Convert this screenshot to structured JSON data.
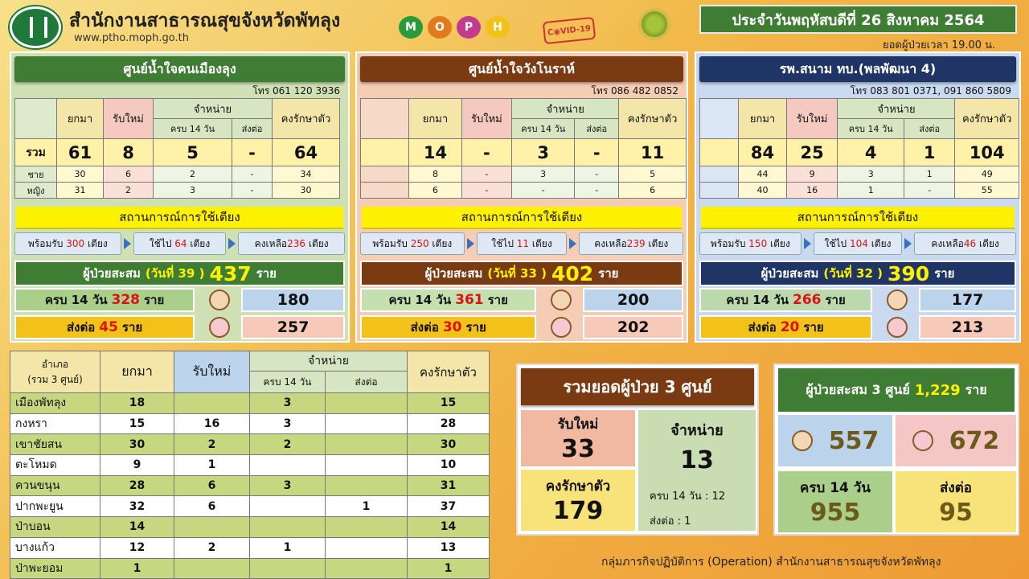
{
  "header": {
    "org": "สำนักงานสาธารณสุขจังหวัดพัทลุง",
    "web": "www.ptho.moph.go.th",
    "moph": [
      "M",
      "O",
      "P",
      "H"
    ],
    "covid": "C◉VID-19",
    "date": "ประจำวันพฤหัสบดีที่ 26 สิงหาคม 2564",
    "time": "ยอดผู้ป่วยเวลา 19.00 น."
  },
  "labels": {
    "carried": "ยกมา",
    "new": "รับใหม่",
    "discharge": "จำหน่าย",
    "d14": "ครบ 14 วัน",
    "refer": "ส่งต่อ",
    "remain": "คงรักษาตัว",
    "total": "รวม",
    "male": "ชาย",
    "female": "หญิง",
    "bed_title": "สถานการณ์การใช้เตียง",
    "acc_label": "ผู้ป่วยสะสม",
    "unit": "ราย"
  },
  "centers": [
    {
      "title": "ศูนย์น้ำใจคนเมืองลุง",
      "phone": "โทร 061 120 3936",
      "total": [
        "61",
        "8",
        "5",
        "-",
        "64"
      ],
      "male": [
        "30",
        "6",
        "2",
        "-",
        "34"
      ],
      "female": [
        "31",
        "2",
        "3",
        "-",
        "30"
      ],
      "bed_ready": "พร้อมรับ",
      "bed_ready_n": "300",
      "bed_used": "ใช้ไป",
      "bed_used_n": "64",
      "bed_left": "คงเหลือ",
      "bed_left_n": "236",
      "bed_unit": "เตียง",
      "acc_day": "(วันที่ 39 )",
      "acc_num": "437",
      "d14_label": "ครบ 14 วัน",
      "d14_num": "328",
      "refer_label": "ส่งต่อ",
      "refer_num": "45",
      "male_total": "180",
      "female_total": "257"
    },
    {
      "title": "ศูนย์น้ำใจวังโนราห์",
      "phone": "โทร 086 482 0852",
      "total": [
        "14",
        "-",
        "3",
        "-",
        "11"
      ],
      "male": [
        "8",
        "-",
        "3",
        "-",
        "5"
      ],
      "female": [
        "6",
        "-",
        "-",
        "-",
        "6"
      ],
      "bed_ready": "พร้อมรับ",
      "bed_ready_n": "250",
      "bed_used": "ใช้ไป",
      "bed_used_n": "11",
      "bed_left": "คงเหลือ",
      "bed_left_n": "239",
      "bed_unit": "เตียง",
      "acc_day": "(วันที่ 33 )",
      "acc_num": "402",
      "d14_label": "ครบ 14 วัน",
      "d14_num": "361",
      "refer_label": "ส่งต่อ",
      "refer_num": "30",
      "male_total": "200",
      "female_total": "202"
    },
    {
      "title": "รพ.สนาม ทบ.(พลพัฒนา 4)",
      "phone": "โทร 083 801 0371, 091 860 5809",
      "total": [
        "84",
        "25",
        "4",
        "1",
        "104"
      ],
      "male": [
        "44",
        "9",
        "3",
        "1",
        "49"
      ],
      "female": [
        "40",
        "16",
        "1",
        "-",
        "55"
      ],
      "bed_ready": "พร้อมรับ",
      "bed_ready_n": "150",
      "bed_used": "ใช้ไป",
      "bed_used_n": "104",
      "bed_left": "คงเหลือ",
      "bed_left_n": "46",
      "bed_unit": "เตียง",
      "acc_day": "(วันที่ 32 )",
      "acc_num": "390",
      "d14_label": "ครบ 14 วัน",
      "d14_num": "266",
      "refer_label": "ส่งต่อ",
      "refer_num": "20",
      "male_total": "177",
      "female_total": "213"
    }
  ],
  "district": {
    "h_amphoe": "อำเภอ",
    "h_sub": "(รวม 3 ศูนย์)",
    "rows": [
      [
        "เมืองพัทลุง",
        "18",
        "",
        "3",
        "",
        "15"
      ],
      [
        "กงหรา",
        "15",
        "16",
        "3",
        "",
        "28"
      ],
      [
        "เขาชัยสน",
        "30",
        "2",
        "2",
        "",
        "30"
      ],
      [
        "ตะโหมด",
        "9",
        "1",
        "",
        "",
        "10"
      ],
      [
        "ควนขนุน",
        "28",
        "6",
        "3",
        "",
        "31"
      ],
      [
        "ปากพะยูน",
        "32",
        "6",
        "",
        "1",
        "37"
      ],
      [
        "ป่าบอน",
        "14",
        "",
        "",
        "",
        "14"
      ],
      [
        "บางแก้ว",
        "12",
        "2",
        "1",
        "",
        "13"
      ],
      [
        "ป่าพะยอม",
        "1",
        "",
        "",
        "",
        "1"
      ]
    ]
  },
  "summary": {
    "title": "รวมยอดผู้ป่วย 3 ศูนย์",
    "new_label": "รับใหม่",
    "new": "33",
    "remain_label": "คงรักษาตัว",
    "remain": "179",
    "dis_label": "จำหน่าย",
    "dis": "13",
    "d14_line": "ครบ 14 วัน   : 12",
    "refer_line": "ส่งต่อ : 1"
  },
  "cumulative": {
    "label": "ผู้ป่วยสะสม 3 ศูนย์",
    "num": "1,229",
    "unit": "ราย",
    "male": "557",
    "female": "672",
    "d14_label": "ครบ 14 วัน",
    "d14": "955",
    "refer_label": "ส่งต่อ",
    "refer": "95"
  },
  "footer": "กลุ่มภารกิจปฏิบัติการ (Operation) สำนักงานสาธารณสุขจังหวัดพัทลุง",
  "colors": {
    "green": "#3f7d34",
    "brown": "#7a3a12",
    "navy": "#1f3566",
    "yellow": "#fff200"
  }
}
